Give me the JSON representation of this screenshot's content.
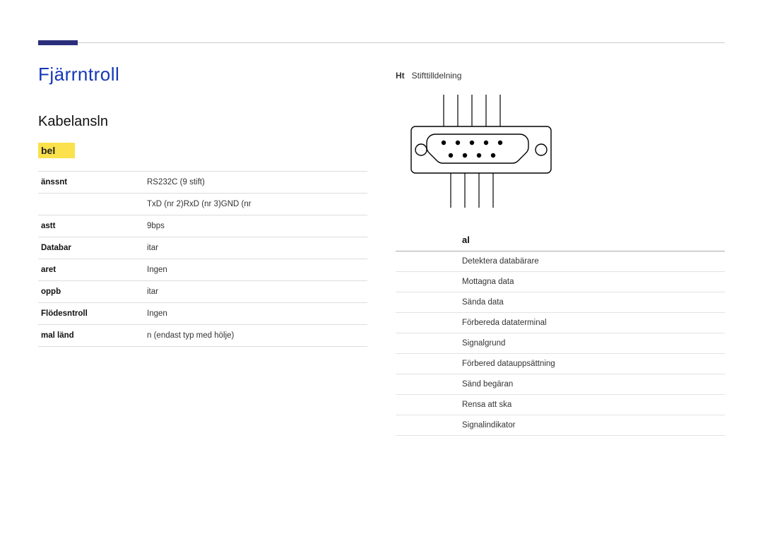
{
  "header": {
    "main_title": "Fjärr​ntroll ​",
    "sub_title": "Kabelansl​n​​",
    "cable_label": "​bel"
  },
  "spec_rows": [
    {
      "label": "​änssn​t",
      "value": "RS232C (9 stift)"
    },
    {
      "label": "​​",
      "value": "TxD (nr 2)​RxD (nr 3)​GND (nr ​"
    },
    {
      "label": "​ast​t",
      "value": "9​bps"
    },
    {
      "label": "Datab​ar",
      "value": "​itar"
    },
    {
      "label": "​ar​et",
      "value": "Ingen"
    },
    {
      "label": "​oppb​",
      "value": "​itar"
    },
    {
      "label": "Flödes​ntroll",
      "value": "Ingen"
    },
    {
      "label": "​mal län​d",
      "value": "​n (endast typ med hölje)"
    }
  ],
  "right": {
    "ht": "Ht",
    "stift": "Stifttilldelning",
    "col1": "​​",
    "col2": "​al"
  },
  "pins": [
    {
      "n": "​",
      "sig": "Detektera databärare"
    },
    {
      "n": "​",
      "sig": "Mottagna data"
    },
    {
      "n": "​",
      "sig": "Sända data"
    },
    {
      "n": "​",
      "sig": "Förbereda dataterminal"
    },
    {
      "n": "​",
      "sig": "Signalgrund"
    },
    {
      "n": "​",
      "sig": "Förbered datauppsättning"
    },
    {
      "n": "​",
      "sig": "Sänd begäran"
    },
    {
      "n": "​",
      "sig": "Rensa att sk​a"
    },
    {
      "n": "​",
      "sig": "Signalindikator"
    }
  ]
}
